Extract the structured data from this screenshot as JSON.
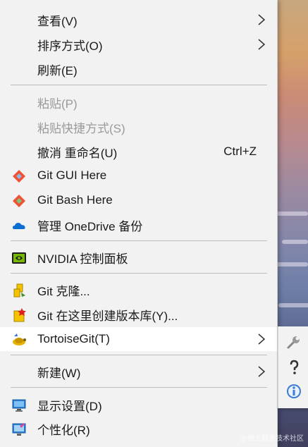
{
  "menu": {
    "items": [
      {
        "label": "查看(V)",
        "submenu": true
      },
      {
        "label": "排序方式(O)",
        "submenu": true
      },
      {
        "label": "刷新(E)"
      },
      {
        "label": "粘贴(P)",
        "disabled": true
      },
      {
        "label": "粘贴快捷方式(S)",
        "disabled": true
      },
      {
        "label": "撤消 重命名(U)",
        "shortcut": "Ctrl+Z"
      },
      {
        "label": "Git GUI Here",
        "icon": "git-gui-icon"
      },
      {
        "label": "Git Bash Here",
        "icon": "git-bash-icon"
      },
      {
        "label": "管理 OneDrive 备份",
        "icon": "onedrive-cloud-icon"
      },
      {
        "label": "NVIDIA 控制面板",
        "icon": "nvidia-icon"
      },
      {
        "label": "Git 克隆...",
        "icon": "tortoisegit-clone-icon"
      },
      {
        "label": "Git 在这里创建版本库(Y)...",
        "icon": "tortoisegit-create-repo-icon"
      },
      {
        "label": "TortoiseGit(T)",
        "icon": "tortoisegit-icon",
        "submenu": true,
        "highlighted": true
      },
      {
        "label": "新建(W)",
        "submenu": true
      },
      {
        "label": "显示设置(D)",
        "icon": "display-settings-icon"
      },
      {
        "label": "个性化(R)",
        "icon": "personalize-icon"
      }
    ]
  },
  "submenu": {
    "items": [
      {
        "icon": "wrench-icon"
      },
      {
        "icon": "help-icon"
      },
      {
        "icon": "info-icon"
      }
    ]
  },
  "watermark": "@稀土掘金技术社区",
  "colors": {
    "menu_bg": "#f2f2f2",
    "hover_bg": "#ffffff",
    "disabled_text": "#9a9a9a",
    "separator": "#bdbdbd"
  }
}
